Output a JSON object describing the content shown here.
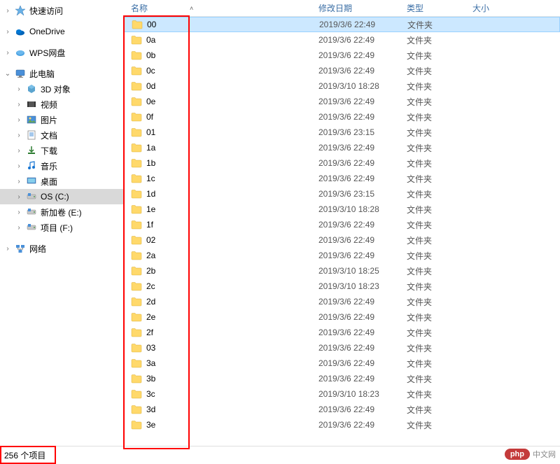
{
  "sidebar": {
    "items": [
      {
        "label": "快速访问",
        "icon": "star",
        "chevron": "right",
        "indent": 1
      },
      {
        "label": "OneDrive",
        "icon": "onedrive",
        "chevron": "right",
        "indent": 1
      },
      {
        "label": "WPS网盘",
        "icon": "wps",
        "chevron": "right",
        "indent": 1
      },
      {
        "label": "此电脑",
        "icon": "pc",
        "chevron": "down",
        "indent": 1
      },
      {
        "label": "3D 对象",
        "icon": "3d",
        "chevron": "right",
        "indent": 2
      },
      {
        "label": "视频",
        "icon": "video",
        "chevron": "right",
        "indent": 2
      },
      {
        "label": "图片",
        "icon": "picture",
        "chevron": "right",
        "indent": 2
      },
      {
        "label": "文档",
        "icon": "doc",
        "chevron": "right",
        "indent": 2
      },
      {
        "label": "下载",
        "icon": "download",
        "chevron": "right",
        "indent": 2
      },
      {
        "label": "音乐",
        "icon": "music",
        "chevron": "right",
        "indent": 2
      },
      {
        "label": "桌面",
        "icon": "desktop",
        "chevron": "right",
        "indent": 2
      },
      {
        "label": "OS (C:)",
        "icon": "drive",
        "chevron": "right",
        "indent": 2,
        "selected": true
      },
      {
        "label": "新加卷 (E:)",
        "icon": "drive",
        "chevron": "right",
        "indent": 2
      },
      {
        "label": "项目 (F:)",
        "icon": "drive",
        "chevron": "right",
        "indent": 2
      },
      {
        "label": "网络",
        "icon": "network",
        "chevron": "right",
        "indent": 1
      }
    ]
  },
  "columns": {
    "name": "名称",
    "date": "修改日期",
    "type": "类型",
    "size": "大小"
  },
  "folder_type": "文件夹",
  "files": [
    {
      "name": "00",
      "date": "2019/3/6 22:49",
      "selected": true
    },
    {
      "name": "0a",
      "date": "2019/3/6 22:49"
    },
    {
      "name": "0b",
      "date": "2019/3/6 22:49"
    },
    {
      "name": "0c",
      "date": "2019/3/6 22:49"
    },
    {
      "name": "0d",
      "date": "2019/3/10 18:28"
    },
    {
      "name": "0e",
      "date": "2019/3/6 22:49"
    },
    {
      "name": "0f",
      "date": "2019/3/6 22:49"
    },
    {
      "name": "01",
      "date": "2019/3/6 23:15"
    },
    {
      "name": "1a",
      "date": "2019/3/6 22:49"
    },
    {
      "name": "1b",
      "date": "2019/3/6 22:49"
    },
    {
      "name": "1c",
      "date": "2019/3/6 22:49"
    },
    {
      "name": "1d",
      "date": "2019/3/6 23:15"
    },
    {
      "name": "1e",
      "date": "2019/3/10 18:28"
    },
    {
      "name": "1f",
      "date": "2019/3/6 22:49"
    },
    {
      "name": "02",
      "date": "2019/3/6 22:49"
    },
    {
      "name": "2a",
      "date": "2019/3/6 22:49"
    },
    {
      "name": "2b",
      "date": "2019/3/10 18:25"
    },
    {
      "name": "2c",
      "date": "2019/3/10 18:23"
    },
    {
      "name": "2d",
      "date": "2019/3/6 22:49"
    },
    {
      "name": "2e",
      "date": "2019/3/6 22:49"
    },
    {
      "name": "2f",
      "date": "2019/3/6 22:49"
    },
    {
      "name": "03",
      "date": "2019/3/6 22:49"
    },
    {
      "name": "3a",
      "date": "2019/3/6 22:49"
    },
    {
      "name": "3b",
      "date": "2019/3/6 22:49"
    },
    {
      "name": "3c",
      "date": "2019/3/10 18:23"
    },
    {
      "name": "3d",
      "date": "2019/3/6 22:49"
    },
    {
      "name": "3e",
      "date": "2019/3/6 22:49"
    }
  ],
  "status": {
    "text": "256 个项目"
  },
  "watermark": {
    "badge": "php",
    "text": "中文网"
  }
}
